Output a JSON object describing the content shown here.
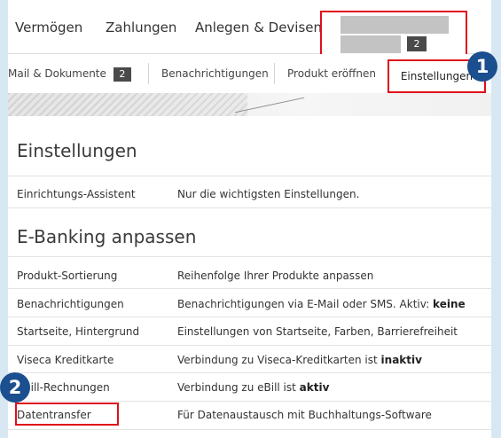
{
  "topnav": {
    "items": [
      "Vermögen",
      "Zahlungen",
      "Anlegen & Devisen"
    ],
    "account_count": "2"
  },
  "subnav": {
    "tabs": [
      "Mail & Dokumente",
      "Benachrichtigungen",
      "Produkt eröffnen",
      "Einstellungen"
    ],
    "mail_badge": "2"
  },
  "sections": [
    {
      "title": "Einstellungen",
      "rows": [
        {
          "label": "Einrichtungs-Assistent",
          "desc": "Nur die wichtigsten Einstellungen."
        }
      ]
    },
    {
      "title": "E-Banking anpassen",
      "rows": [
        {
          "label": "Produkt-Sortierung",
          "desc": "Reihenfolge Ihrer Produkte anpassen"
        },
        {
          "label": "Benachrichtigungen",
          "desc": "Benachrichtigungen via E-Mail oder SMS. Aktiv: ",
          "status": "keine"
        },
        {
          "label": "Startseite, Hintergrund",
          "desc": "Einstellungen von Startseite, Farben, Barrierefreiheit"
        },
        {
          "label": "Viseca Kreditkarte",
          "desc": "Verbindung zu Viseca-Kreditkarten ist ",
          "status": "inaktiv"
        },
        {
          "label": "eBill-Rechnungen",
          "desc": "Verbindung zu eBill ist ",
          "status": "aktiv"
        },
        {
          "label": "Datentransfer",
          "desc": "Für Datenaustausch mit Buchhaltungs-Software"
        }
      ]
    }
  ],
  "markers": [
    "1",
    "2"
  ],
  "colors": {
    "highlight": "#e0101a",
    "marker": "#1b4f8f",
    "background": "#d8e8f2"
  }
}
